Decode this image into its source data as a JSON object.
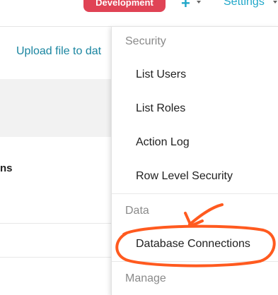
{
  "header": {
    "environment_badge": "Development",
    "plus_button": "+",
    "settings_label": "Settings"
  },
  "background": {
    "upload_link": "Upload file to dat",
    "column_fragment": "ns"
  },
  "menu": {
    "sections": [
      {
        "header": "Security",
        "items": [
          "List Users",
          "List Roles",
          "Action Log",
          "Row Level Security"
        ]
      },
      {
        "header": "Data",
        "items": [
          "Database Connections"
        ]
      },
      {
        "header": "Manage",
        "items": []
      }
    ]
  },
  "colors": {
    "badge": "#e04355",
    "link": "#20a7c9",
    "annotation": "#ff5a1f"
  }
}
